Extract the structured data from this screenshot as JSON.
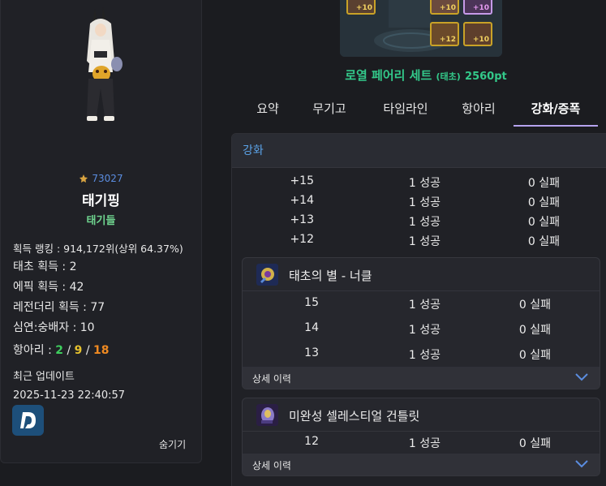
{
  "profile": {
    "fame": "73027",
    "name": "태기핑",
    "guild": "태기들",
    "rank_line": "획득 랭킹 : 914,172위(상위 64.37%)",
    "stats": [
      "태초 획득 : 2",
      "에픽 획득 : 42",
      "레전더리 획득 : 77",
      "심연:숭배자 : 10"
    ],
    "hangari_label": "항아리 : ",
    "hangari_values": [
      "2",
      "9",
      "18"
    ],
    "hangari_sep": " / ",
    "updated_label": "최근 업데이트",
    "updated_time": "2025-11-23 22:40:57",
    "hide_label": "숨기기",
    "icons": [
      "character-portrait",
      "fame-icon",
      "dnf-d-logo"
    ]
  },
  "set": {
    "name": "로열 페어리 세트",
    "sub": "(태초)",
    "points": "2560pt",
    "slot_levels": [
      "+10",
      "+10",
      "+10",
      "+12",
      "+10"
    ]
  },
  "tabs": [
    "요약",
    "무기고",
    "타임라인",
    "항아리",
    "강화/증폭"
  ],
  "active_tab": "강화/증폭",
  "enhance": {
    "header": "강화",
    "rows": [
      {
        "level": "+15",
        "success": "1 성공",
        "fail": "0 실패"
      },
      {
        "level": "+14",
        "success": "1 성공",
        "fail": "0 실패"
      },
      {
        "level": "+13",
        "success": "1 성공",
        "fail": "0 실패"
      },
      {
        "level": "+12",
        "success": "1 성공",
        "fail": "0 실패"
      }
    ],
    "items": [
      {
        "name": "태초의 별 - 너클",
        "rows": [
          {
            "level": "15",
            "success": "1 성공",
            "fail": "0 실패"
          },
          {
            "level": "14",
            "success": "1 성공",
            "fail": "0 실패"
          },
          {
            "level": "13",
            "success": "1 성공",
            "fail": "0 실패"
          }
        ],
        "detail_label": "상세 이력"
      },
      {
        "name": "미완성 셀레스티얼 건틀릿",
        "rows": [
          {
            "level": "12",
            "success": "1 성공",
            "fail": "0 실패"
          }
        ],
        "detail_label": "상세 이력"
      }
    ]
  },
  "colors": {
    "accent_tab": "#b5a3ef",
    "header_text": "#5ba3e8",
    "guild": "#6fd58f",
    "set_name": "#33c98a",
    "hangari": [
      "#3ecf5e",
      "#e5c12e",
      "#f08a21"
    ]
  }
}
